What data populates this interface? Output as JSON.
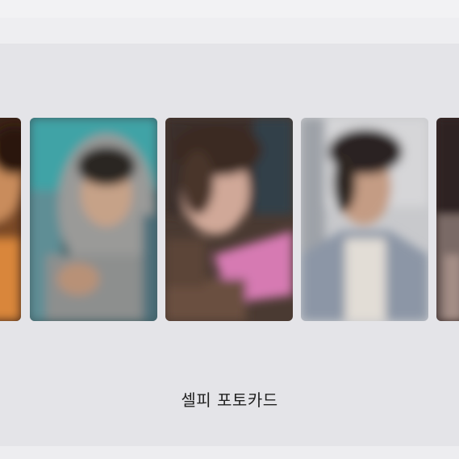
{
  "caption": "셀피 포토카드",
  "cards": [
    {
      "icon": "person-photo-brown"
    },
    {
      "icon": "person-photo-hoodie"
    },
    {
      "icon": "person-photo-pink"
    },
    {
      "icon": "person-photo-gray-jacket"
    },
    {
      "icon": "person-photo-dark"
    }
  ]
}
